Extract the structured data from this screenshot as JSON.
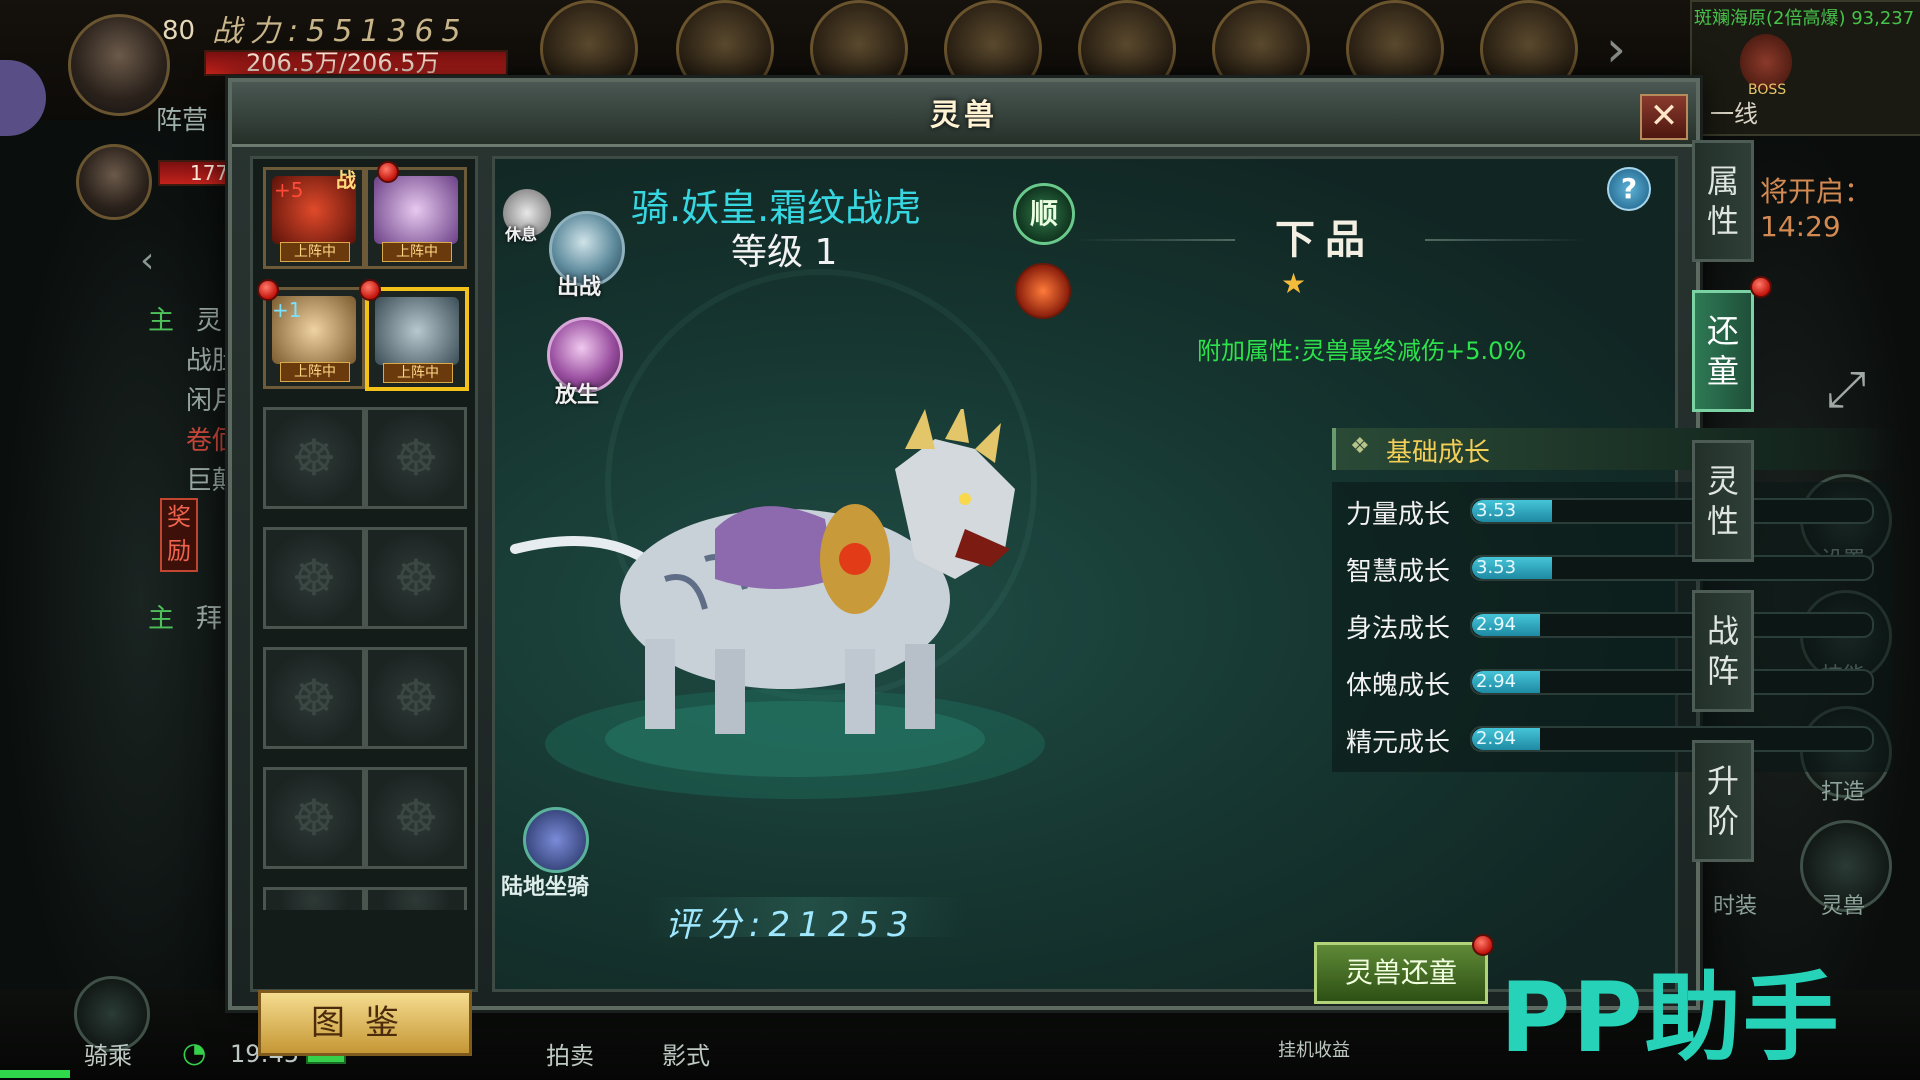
{
  "hud": {
    "player_level": "80",
    "combat_power": "战力:551365",
    "hp": "206.5万/206.5万",
    "camp": "阵营",
    "second_value": "177",
    "map_name": "斑斓海原(2倍高爆) 93,237",
    "boss_label": "BOSS",
    "line": "一线",
    "event_timer": "将开启：14:29",
    "left_list": [
      "灵",
      "战肚",
      "闲月",
      "卷偭",
      "巨颠"
    ],
    "reward_label_1": "奖",
    "reward_label_2": "励",
    "zhu_1": "主",
    "zhu_2": "主",
    "bai": "拜",
    "time": "19:45",
    "bottom_left": "骑乘",
    "bottom_mid_1": "拍卖",
    "bottom_mid_2": "影式",
    "bottom_right": "挂机收益",
    "right_icons": [
      "设置",
      "技能",
      "打造",
      "灵兽",
      "时装"
    ],
    "watermark": "PP助手"
  },
  "dialog": {
    "title": "灵兽",
    "close_icon": "close-icon",
    "slots": [
      {
        "tag": "战",
        "badge": "+5",
        "status": "上阵中",
        "color": "#b23a1e"
      },
      {
        "tag": "",
        "badge": "",
        "status": "上阵中",
        "color": "#8d5aa8"
      },
      {
        "tag": "",
        "badge": "+1",
        "status": "上阵中",
        "color": "#c08a48"
      },
      {
        "tag": "",
        "badge": "",
        "status": "上阵中",
        "color": "#5c6e74"
      }
    ],
    "empty_slot_count": 8,
    "tujian": "图鉴",
    "pet": {
      "name": "骑.妖皇.霜纹战虎",
      "level_label": "等级 1",
      "rest": "休息",
      "battle": "出战",
      "release": "放生",
      "temperament": "顺",
      "mount_type": "陆地坐骑",
      "score": "评分:21253"
    },
    "quality": "下品",
    "stars": "★",
    "bonus": "附加属性:灵兽最终减伤+5.0%",
    "growth": {
      "title": "基础成长",
      "stats": [
        {
          "label": "力量成长",
          "value": "3.53",
          "fill": 0.2
        },
        {
          "label": "智慧成长",
          "value": "3.53",
          "fill": 0.2
        },
        {
          "label": "身法成长",
          "value": "2.94",
          "fill": 0.17
        },
        {
          "label": "体魄成长",
          "value": "2.94",
          "fill": 0.17
        },
        {
          "label": "精元成长",
          "value": "2.94",
          "fill": 0.17
        }
      ]
    },
    "reset_button": "灵兽还童",
    "tabs": [
      {
        "label": "属性",
        "active": false
      },
      {
        "label": "还童",
        "active": true
      },
      {
        "label": "灵性",
        "active": false
      },
      {
        "label": "战阵",
        "active": false
      },
      {
        "label": "升阶",
        "active": false
      }
    ],
    "help": "?"
  }
}
